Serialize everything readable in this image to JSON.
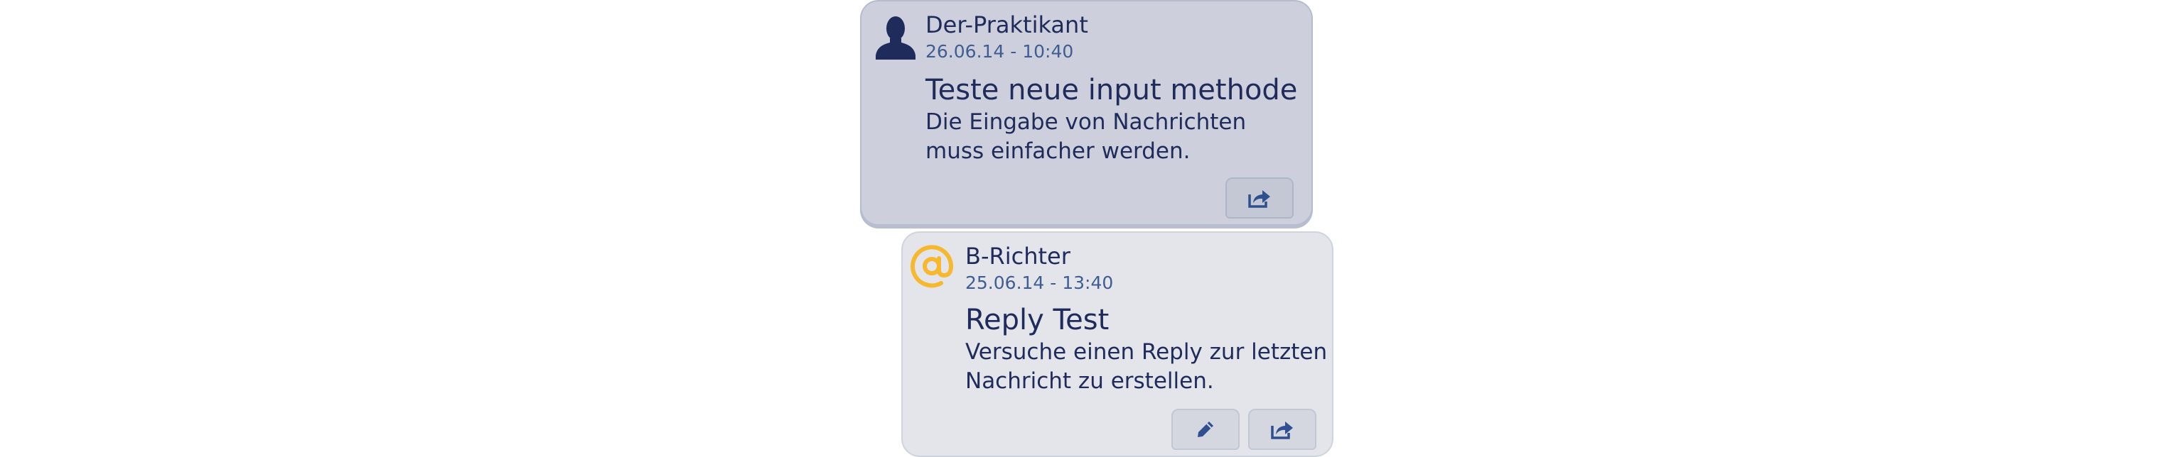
{
  "colors": {
    "text_primary": "#1f2b5b",
    "timestamp": "#3f5d92",
    "mention_accent": "#f5b82e",
    "card_own_bg": "#cdd0dc",
    "card_other_bg": "#e4e5ea"
  },
  "messages": [
    {
      "avatar_icon": "user-silhouette-icon",
      "author": "Der-Praktikant",
      "timestamp": "26.06.14 - 10:40",
      "title": "Teste neue input methode",
      "body": "Die Eingabe von Nachrichten muss einfacher werden.",
      "actions": [
        {
          "icon": "share-icon"
        }
      ]
    },
    {
      "avatar_icon": "at-sign-icon",
      "author": "B-Richter",
      "timestamp": "25.06.14 - 13:40",
      "title": "Reply Test",
      "body": "Versuche einen Reply zur letzten Nachricht zu erstellen.",
      "actions": [
        {
          "icon": "edit-pencil-icon"
        },
        {
          "icon": "share-icon"
        }
      ]
    }
  ]
}
